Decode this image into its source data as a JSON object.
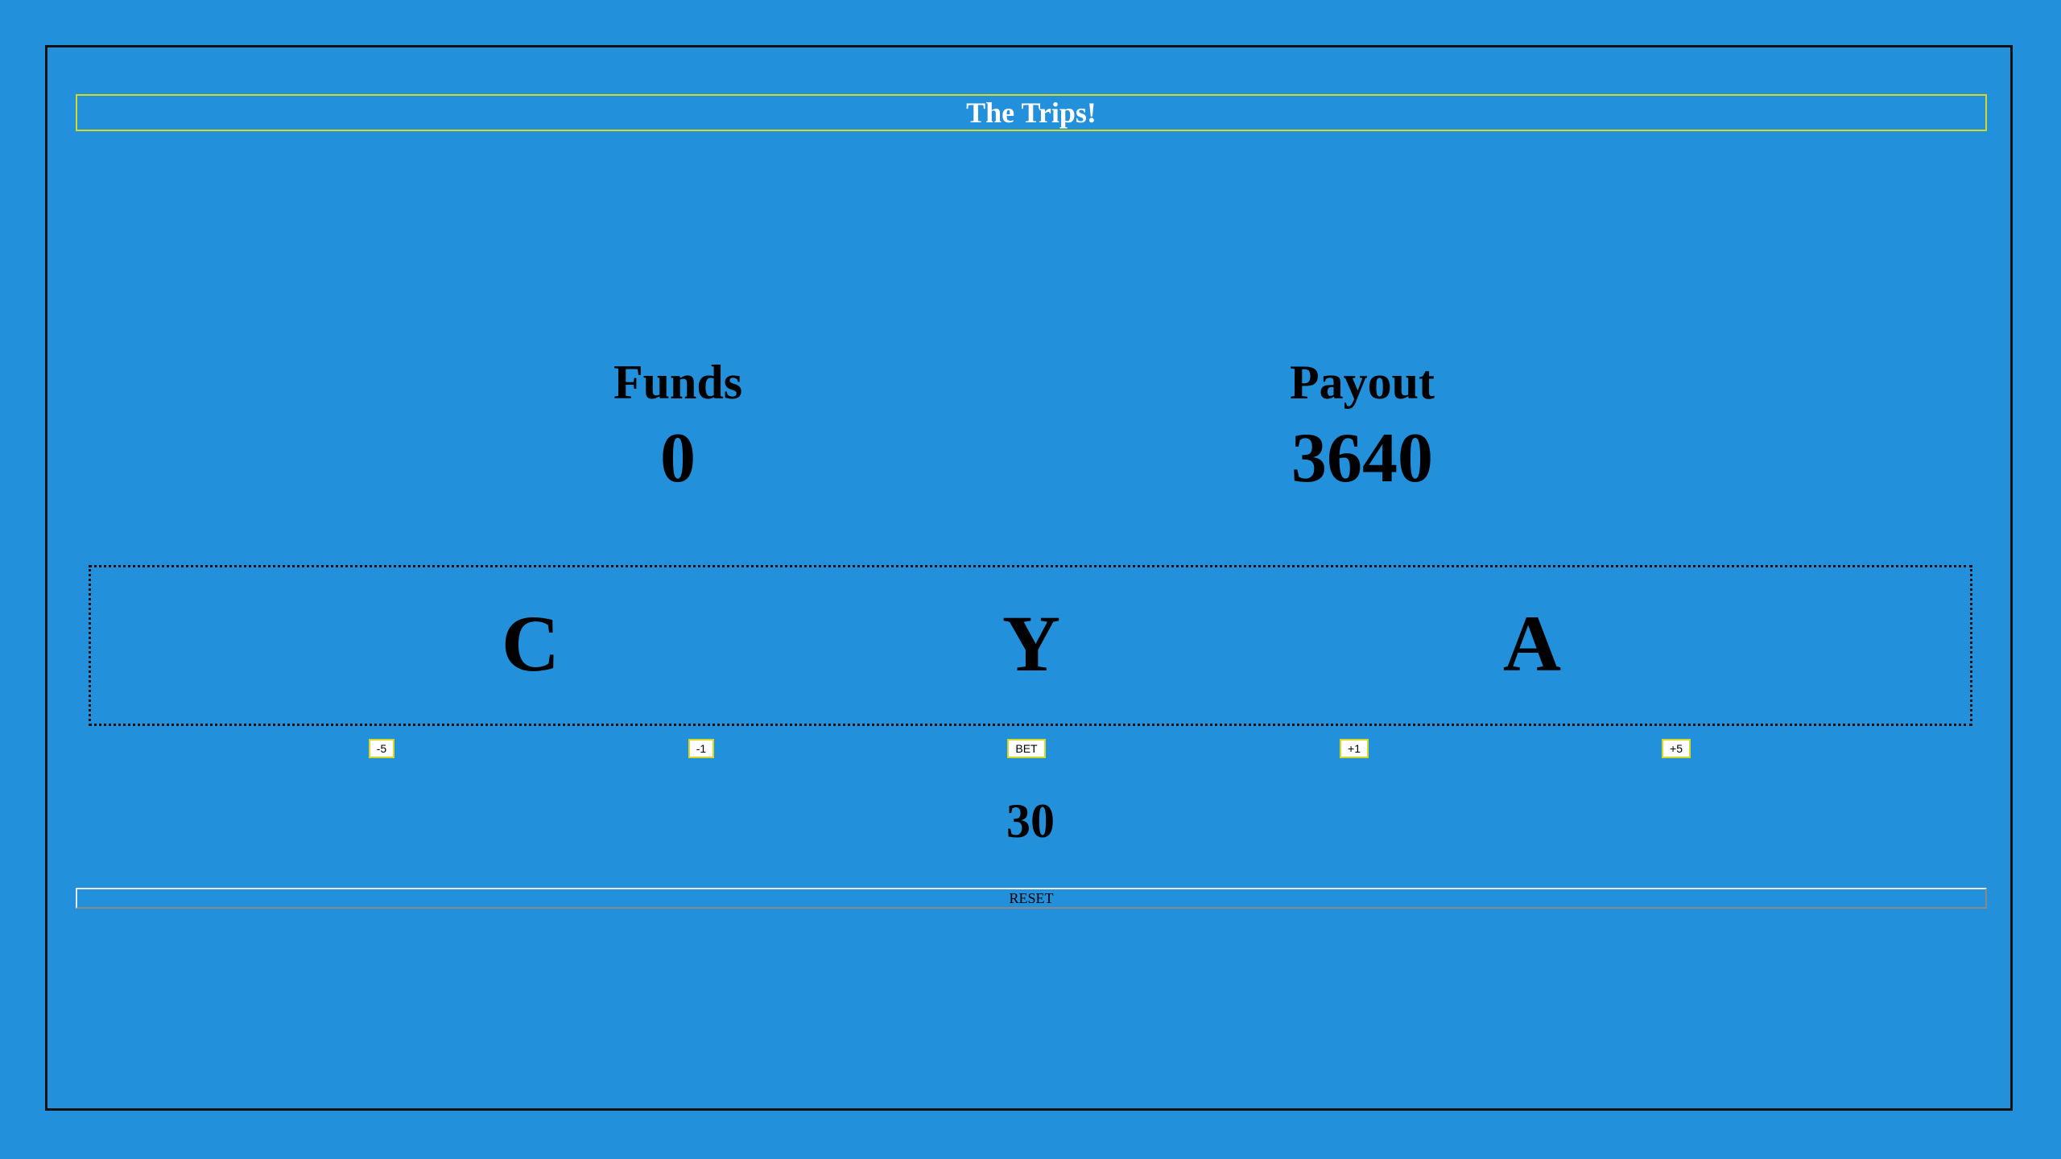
{
  "game": {
    "title": "The Trips!"
  },
  "stats": {
    "funds_label": "Funds",
    "funds_value": "0",
    "payout_label": "Payout",
    "payout_value": "3640"
  },
  "reels": [
    "C",
    "Y",
    "A"
  ],
  "controls": {
    "minus5": "-5",
    "minus1": "-1",
    "bet": "BET",
    "plus1": "+1",
    "plus5": "+5",
    "bet_amount": "30",
    "reset": "RESET"
  },
  "colors": {
    "background": "#2290da",
    "title_border": "#d8d820",
    "title_text": "#ffffff"
  }
}
